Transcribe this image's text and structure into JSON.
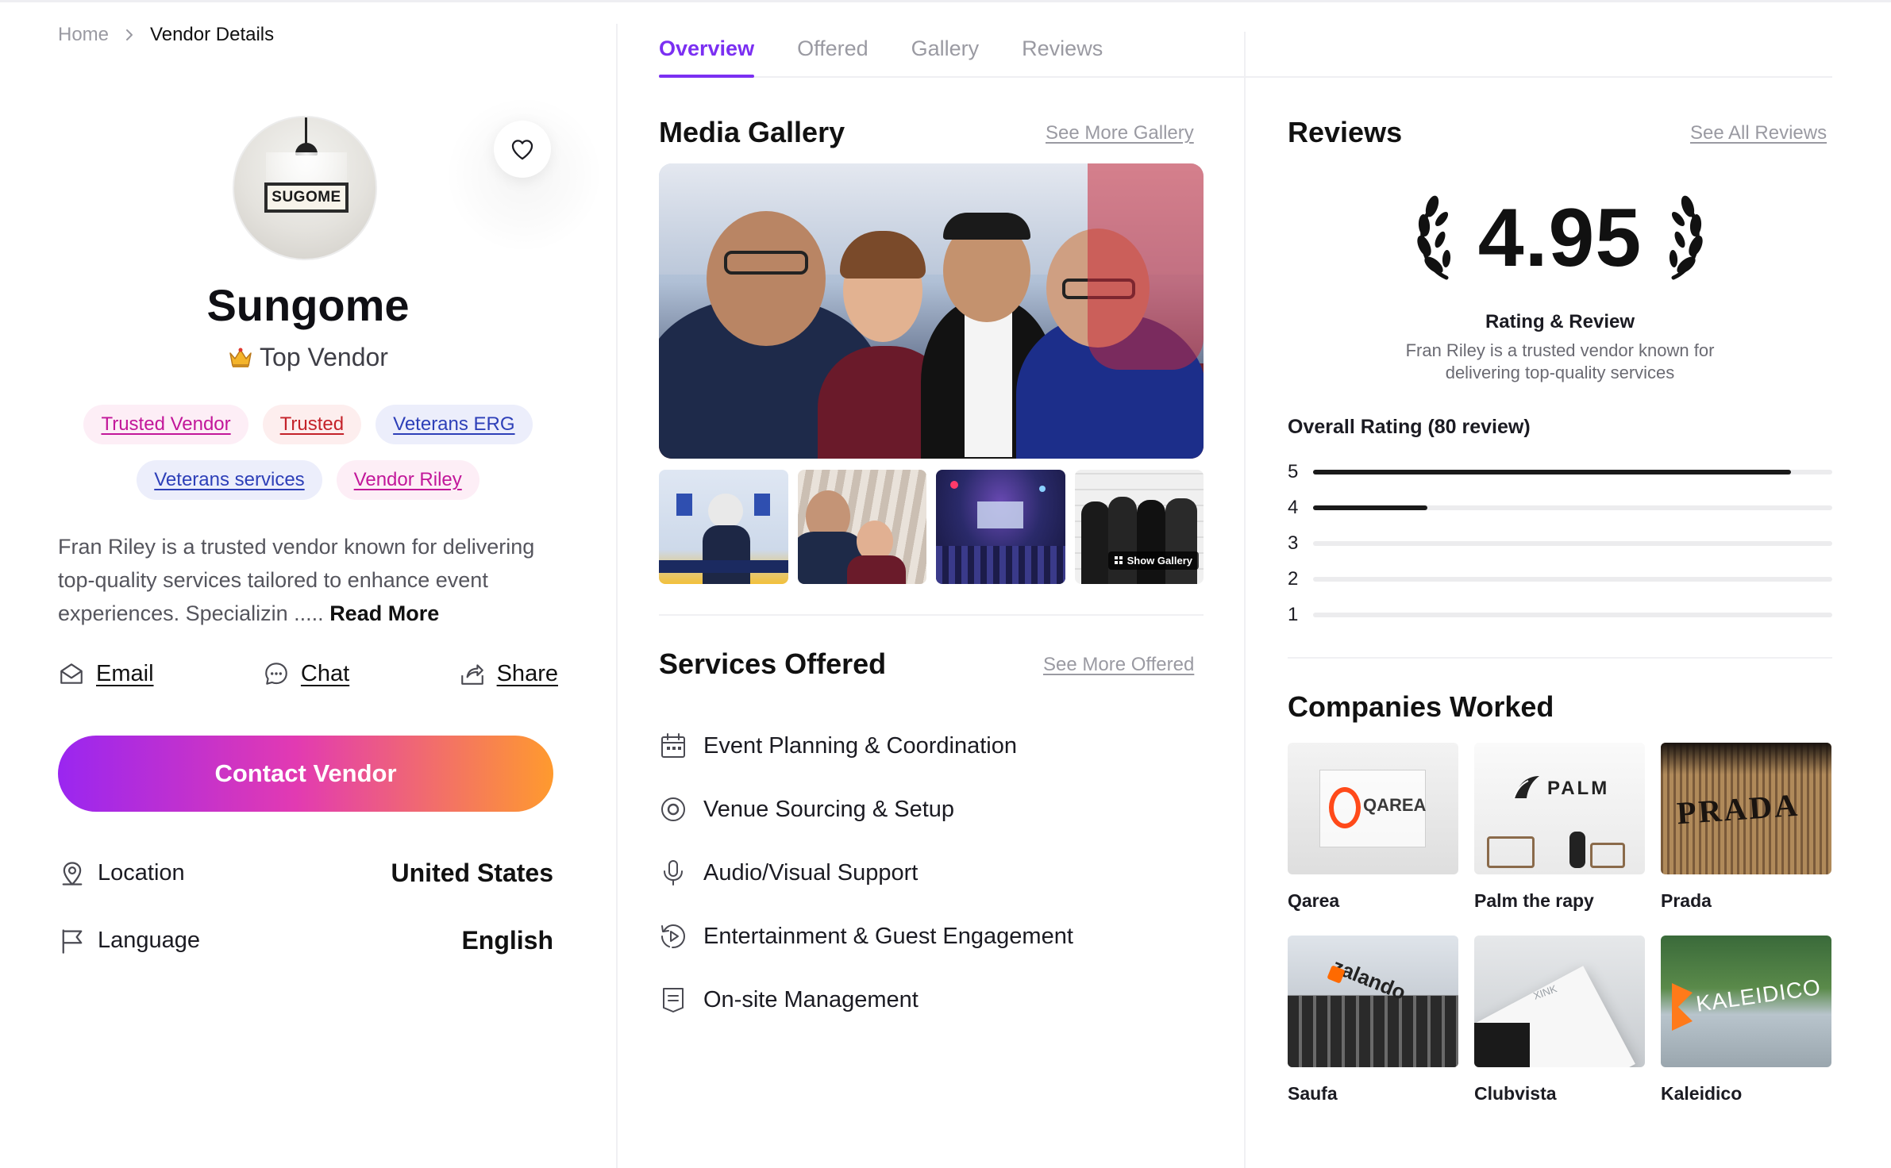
{
  "breadcrumb": {
    "home": "Home",
    "current": "Vendor Details"
  },
  "vendor": {
    "avatar_sign": "SUGOME",
    "name": "Sungome",
    "rank": "Top Vendor",
    "tags": [
      {
        "label": "Trusted Vendor",
        "style": "pink"
      },
      {
        "label": "Trusted",
        "style": "red"
      },
      {
        "label": "Veterans ERG",
        "style": "blue"
      },
      {
        "label": "Veterans services",
        "style": "blue"
      },
      {
        "label": "Vendor Riley",
        "style": "pink"
      }
    ],
    "bio": "Fran Riley is a trusted vendor known for delivering top-quality services tailored to enhance event experiences. Specializin .....",
    "read_more": "Read More"
  },
  "actions": {
    "email": "Email",
    "chat": "Chat",
    "share": "Share"
  },
  "contact_button": "Contact Vendor",
  "info": {
    "location_label": "Location",
    "location_value": "United States",
    "language_label": "Language",
    "language_value": "English"
  },
  "tabs": [
    {
      "label": "Overview",
      "active": true
    },
    {
      "label": "Offered",
      "active": false
    },
    {
      "label": "Gallery",
      "active": false
    },
    {
      "label": "Reviews",
      "active": false
    }
  ],
  "gallery": {
    "title": "Media Gallery",
    "link": "See More Gallery",
    "show_gallery": "Show Gallery"
  },
  "services": {
    "title": "Services Offered",
    "link": "See More Offered",
    "items": [
      {
        "label": "Event Planning & Coordination",
        "icon": "calendar-icon"
      },
      {
        "label": "Venue Sourcing & Setup",
        "icon": "target-icon"
      },
      {
        "label": "Audio/Visual Support",
        "icon": "microphone-icon"
      },
      {
        "label": "Entertainment & Guest Engagement",
        "icon": "replay-icon"
      },
      {
        "label": "On-site Management",
        "icon": "clipboard-icon"
      }
    ]
  },
  "reviews": {
    "title": "Reviews",
    "link": "See All Reviews",
    "score": "4.95",
    "caption": "Rating & Review",
    "description": "Fran Riley is a trusted vendor known for delivering top-quality services",
    "overall_label": "Overall Rating (80 review)",
    "distribution": [
      {
        "stars": "5",
        "fraction": 0.92
      },
      {
        "stars": "4",
        "fraction": 0.22
      },
      {
        "stars": "3",
        "fraction": 0
      },
      {
        "stars": "2",
        "fraction": 0
      },
      {
        "stars": "1",
        "fraction": 0
      }
    ]
  },
  "companies": {
    "title": "Companies Worked",
    "items": [
      {
        "name": "Qarea",
        "logo_text": "QAREA"
      },
      {
        "name": "Palm the rapy",
        "logo_text": "PALM"
      },
      {
        "name": "Prada",
        "logo_text": "PRADA"
      },
      {
        "name": "Saufa",
        "logo_text": "zalando"
      },
      {
        "name": "Clubvista",
        "logo_text": "XINK"
      },
      {
        "name": "Kaleidico",
        "logo_text": "KALEIDICO"
      }
    ]
  },
  "colors": {
    "accent": "#7b2ff2",
    "gradient_start": "#9a26f0",
    "gradient_mid": "#e23ab2",
    "gradient_end": "#ff9a2e"
  }
}
